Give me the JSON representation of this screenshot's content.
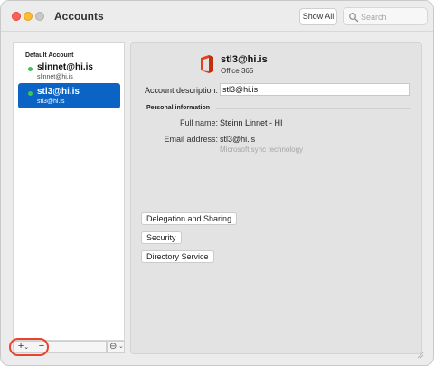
{
  "window": {
    "title": "Accounts"
  },
  "toolbar": {
    "show_all_label": "Show All",
    "search_placeholder": "Search"
  },
  "sidebar": {
    "group_header": "Default Account",
    "accounts": [
      {
        "name": "slinnet@hi.is",
        "email": "slinnet@hi.is",
        "status": "online",
        "selected": false
      },
      {
        "name": "stl3@hi.is",
        "email": "stl3@hi.is",
        "status": "online",
        "selected": true
      }
    ],
    "add_label": "+",
    "add_chevron": "⌄",
    "remove_label": "−",
    "action_icon": "⊖",
    "action_chevron": "⌄"
  },
  "detail": {
    "account_title": "stl3@hi.is",
    "account_type": "Office 365",
    "description_label": "Account description:",
    "description_value": "stl3@hi.is",
    "personal_header": "Personal information",
    "full_name_label": "Full name:",
    "full_name_value": "Steinn Linnet - HI",
    "email_label": "Email address:",
    "email_value": "stl3@hi.is",
    "sync_note": "Microsoft sync technology",
    "buttons": {
      "delegation": "Delegation and Sharing",
      "security": "Security",
      "directory": "Directory Service"
    }
  },
  "colors": {
    "selection": "#0b63c6",
    "status_online": "#3dc454",
    "annotation_ring": "#e8432f",
    "office_orange": "#e3411e"
  }
}
